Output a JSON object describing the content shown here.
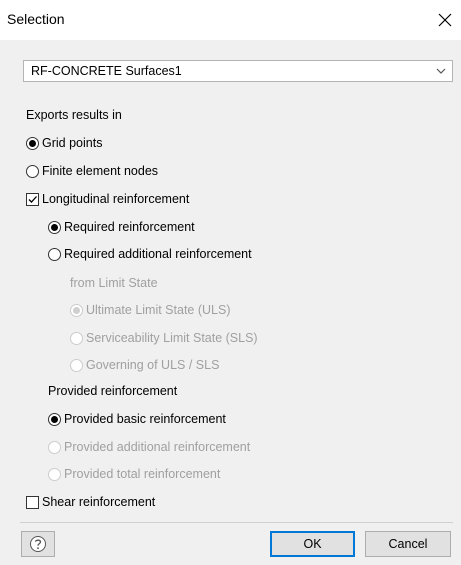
{
  "window": {
    "title": "Selection"
  },
  "combo": {
    "value": "RF-CONCRETE Surfaces1"
  },
  "exports": {
    "label": "Exports results in",
    "grid_points": "Grid points",
    "fe_nodes": "Finite element nodes"
  },
  "longitudinal": {
    "label": "Longitudinal reinforcement",
    "required": "Required reinforcement",
    "required_additional": "Required additional reinforcement",
    "from_limit_state": "from Limit State",
    "uls": "Ultimate Limit State (ULS)",
    "sls": "Serviceability Limit State (SLS)",
    "governing": "Governing of ULS / SLS",
    "provided_label": "Provided reinforcement",
    "provided_basic": "Provided basic reinforcement",
    "provided_additional": "Provided additional reinforcement",
    "provided_total": "Provided total reinforcement"
  },
  "shear": {
    "label": "Shear reinforcement"
  },
  "buttons": {
    "ok": "OK",
    "cancel": "Cancel"
  },
  "icons": {
    "close": "close-icon",
    "dropdown": "chevron-down-icon",
    "help": "help-icon"
  }
}
